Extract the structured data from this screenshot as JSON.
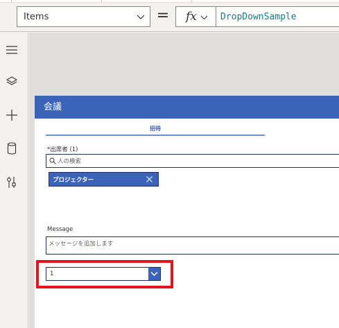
{
  "formula_bar": {
    "property": "Items",
    "equals": "=",
    "fx": "fx",
    "formula": "DropDownSample"
  },
  "left_rail": {
    "icons": [
      "hamburger-menu-icon",
      "layers-icon",
      "plus-icon",
      "database-icon",
      "tools-icon"
    ]
  },
  "screen": {
    "header_title": "会議",
    "tab_label": "招待",
    "attendee_label": "*出席者 (1)",
    "search_placeholder": "人の検索",
    "selected_person": "プロジェクター",
    "message_label": "Message",
    "message_placeholder": "メッセージを追加します",
    "dropdown_value": "1"
  },
  "colors": {
    "header_blue": "#3b63b8",
    "highlight_red": "#e3141b",
    "formula_teal": "#107c8c"
  }
}
